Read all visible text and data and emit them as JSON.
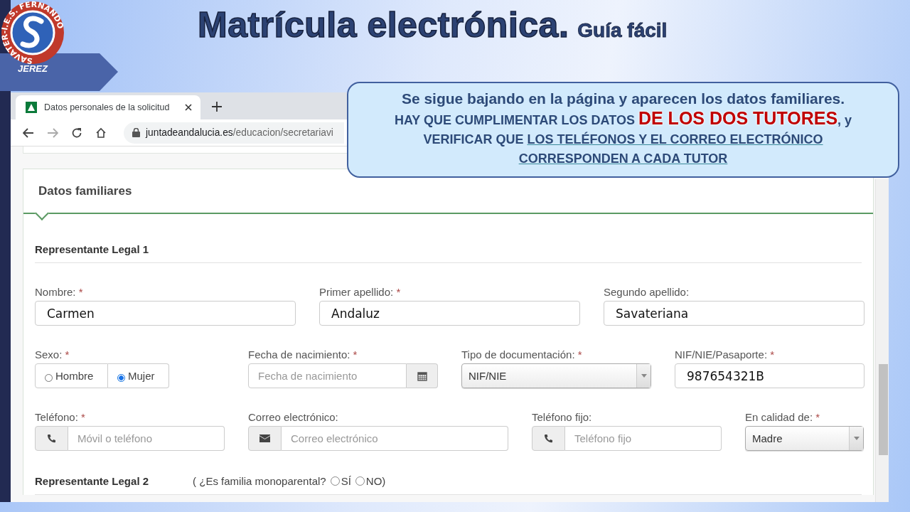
{
  "slide": {
    "title": "Matrícula electrónica.",
    "subtitle": "Guía fácil",
    "logo": {
      "ring_text": "SAVATER-I.E.S. FERNANDO",
      "city": "JEREZ"
    }
  },
  "browser": {
    "tab_title": "Datos personales de la solicitud",
    "url_domain": "juntadeandalucia.es",
    "url_path": "/educacion/secretariavi"
  },
  "page": {
    "section_title": "Datos familiares",
    "representative_1": {
      "title": "Representante Legal 1",
      "rows": [
        [
          {
            "kind": "text",
            "label": "Nombre:",
            "mark": "*",
            "value": "Carmen"
          },
          {
            "kind": "text",
            "label": "Primer apellido:",
            "mark": "*",
            "value": "Andaluz"
          },
          {
            "kind": "text",
            "label": "Segundo apellido:",
            "value": "Savateriana"
          }
        ],
        [
          {
            "kind": "radio",
            "label": "Sexo:",
            "mark": "*",
            "options": [
              {
                "label": "Hombre",
                "selected": false
              },
              {
                "label": "Mujer",
                "selected": true
              }
            ]
          },
          {
            "kind": "date",
            "label": "Fecha de nacimiento:",
            "mark": "*",
            "placeholder": "Fecha de nacimiento"
          },
          {
            "kind": "select",
            "label": "Tipo de documentación:",
            "mark": "*",
            "value": "NIF/NIE"
          },
          {
            "kind": "text",
            "label": "NIF/NIE/Pasaporte:",
            "mark": "*",
            "value": "987654321B"
          }
        ],
        [
          {
            "kind": "phone",
            "label": "Teléfono:",
            "mark": "*",
            "placeholder": "Móvil o teléfono"
          },
          {
            "kind": "email",
            "label": "Correo electrónico:",
            "placeholder": "Correo electrónico"
          },
          {
            "kind": "phone",
            "label": "Teléfono fijo:",
            "placeholder": "Teléfono fijo"
          },
          {
            "kind": "select",
            "label": "En calidad de:",
            "mark": "*",
            "value": "Madre"
          }
        ]
      ]
    },
    "representative_2": {
      "title": "Representante Legal 2",
      "question": "( ¿Es familia monoparental?",
      "options": [
        {
          "label": "SÍ",
          "selected": false
        },
        {
          "label": "NO)",
          "selected": false
        }
      ]
    }
  },
  "callout": {
    "heading": "Se sigue bajando en la página y aparecen los datos familiares.",
    "parts": [
      {
        "kind": "plain",
        "text": "HAY QUE CUMPLIMENTAR LOS DATOS "
      },
      {
        "kind": "emphasis",
        "text": "DE LOS DOS TUTORES"
      },
      {
        "kind": "plain",
        "text": ", y VERIFICAR QUE "
      },
      {
        "kind": "underline",
        "text": "LOS TELÉFONOS Y EL CORREO ELECTRÓNICO CORRESPONDEN A CADA TUTOR"
      }
    ]
  }
}
